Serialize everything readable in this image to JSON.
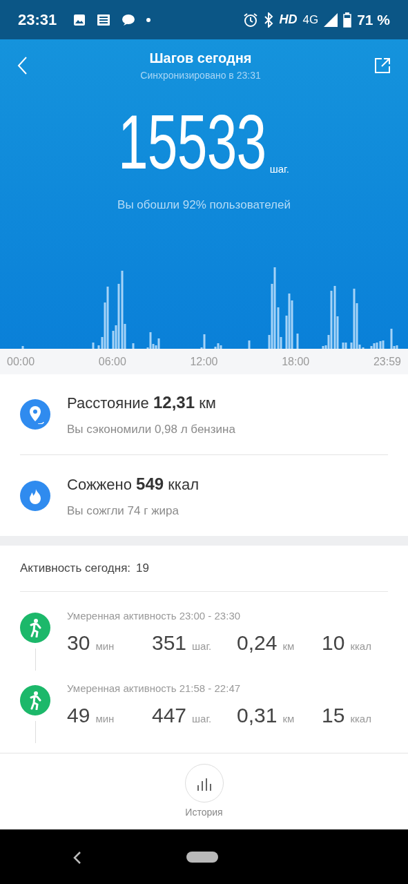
{
  "status_bar": {
    "time": "23:31",
    "hd": "HD",
    "network": "4G",
    "battery": "71 %"
  },
  "header": {
    "title": "Шагов сегодня",
    "subtitle": "Синхронизировано в 23:31"
  },
  "summary": {
    "steps": "15533",
    "unit": "шаг.",
    "comparison": "Вы обошли 92% пользователей"
  },
  "time_labels": [
    "00:00",
    "06:00",
    "12:00",
    "18:00",
    "23:59"
  ],
  "stats": [
    {
      "kind": "distance",
      "title": "Расстояние **12,31** км",
      "note": "Вы сэкономили 0,98 л бензина"
    },
    {
      "kind": "calories",
      "title": "Сожжено **549** ккал",
      "note": "Вы сожгли 74 г жира"
    }
  ],
  "activity": {
    "label": "Активность сегодня:",
    "count": "19",
    "items": [
      {
        "title": "Умеренная активность 23:00 - 23:30",
        "values": [
          {
            "value": "30",
            "unit": "мин"
          },
          {
            "value": "351",
            "unit": "шаг."
          },
          {
            "value": "0,24",
            "unit": "км"
          },
          {
            "value": "10",
            "unit": "ккал"
          }
        ]
      },
      {
        "title": "Умеренная активность 21:58 - 22:47",
        "values": [
          {
            "value": "49",
            "unit": "мин"
          },
          {
            "value": "447",
            "unit": "шаг."
          },
          {
            "value": "0,31",
            "unit": "км"
          },
          {
            "value": "15",
            "unit": "ккал"
          }
        ]
      }
    ]
  },
  "bottom": {
    "history_label": "История"
  }
}
